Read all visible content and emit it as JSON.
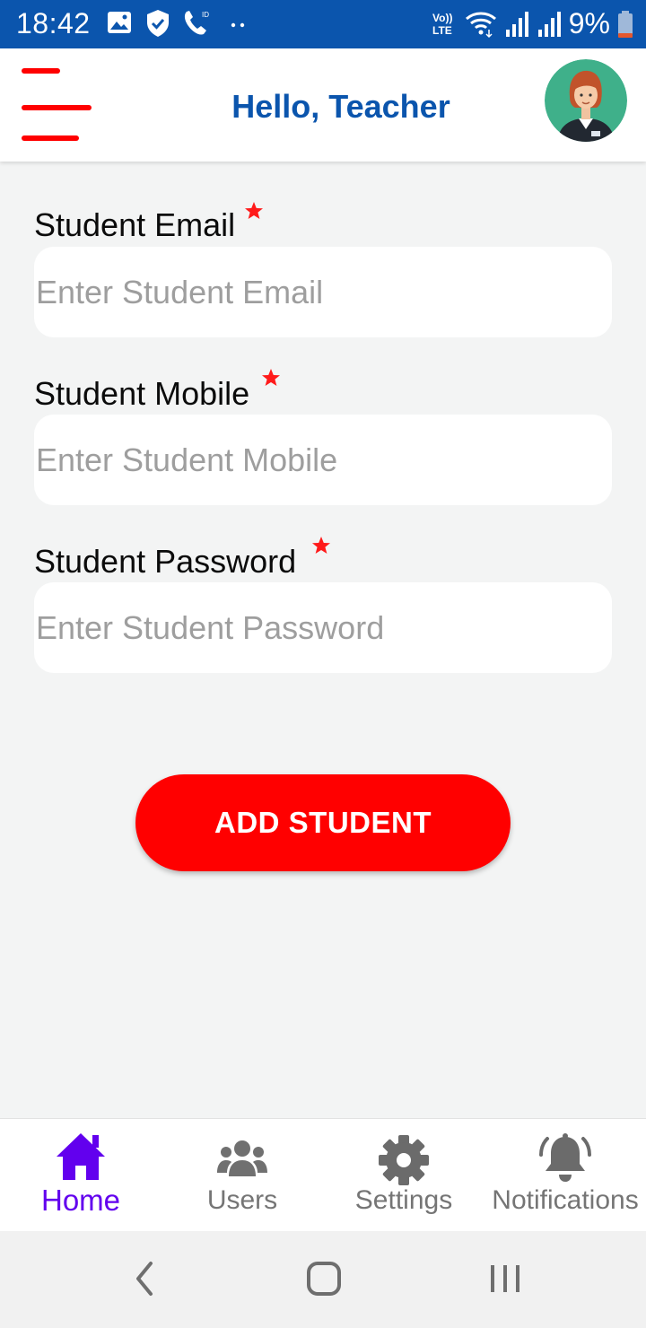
{
  "status_bar": {
    "time": "18:42",
    "battery": "9%",
    "icons": [
      "gallery-icon",
      "shield-icon",
      "wifi-calling-icon",
      "volte-icon",
      "wifi-icon",
      "signal-icon",
      "battery-icon"
    ]
  },
  "header": {
    "title": "Hello, Teacher",
    "menu_icon": "hamburger-menu-icon",
    "avatar_icon": "teacher-avatar"
  },
  "form": {
    "email": {
      "label": "Student Email",
      "placeholder": "Enter Student Email"
    },
    "mobile": {
      "label": "Student Mobile",
      "placeholder": "Enter Student Mobile"
    },
    "password": {
      "label": "Student Password",
      "placeholder": "Enter Student Password"
    },
    "submit_label": "ADD STUDENT"
  },
  "bottom_nav": {
    "items": [
      {
        "label": "Home",
        "icon": "home-icon",
        "active": true
      },
      {
        "label": "Users",
        "icon": "users-icon",
        "active": false
      },
      {
        "label": "Settings",
        "icon": "gear-icon",
        "active": false
      },
      {
        "label": "Notifications",
        "icon": "bell-icon",
        "active": false
      }
    ]
  },
  "colors": {
    "status_bar": "#0b55ad",
    "title": "#0b55ad",
    "accent_red": "#ff0000",
    "active_nav": "#6200ee",
    "inactive_nav": "#757575",
    "background": "#f3f4f4"
  }
}
